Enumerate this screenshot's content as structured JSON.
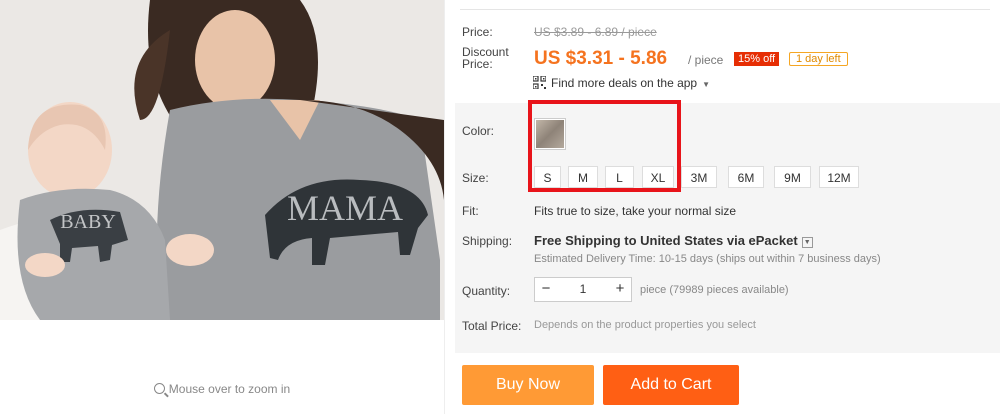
{
  "product_image": {
    "zoom_hint": "Mouse over to zoom in",
    "shirt_texts": [
      "MAMA",
      "BABY"
    ]
  },
  "price": {
    "label": "Price:",
    "original": "US $3.89 - 6.89 / piece",
    "discount_label_line1": "Discount",
    "discount_label_line2": "Price:",
    "discount": "US $3.31 - 5.86",
    "per": "/ piece",
    "off_badge": "15% off",
    "days_badge": "1 day left"
  },
  "app_deals": {
    "text": "Find more deals on the app"
  },
  "color": {
    "label": "Color:"
  },
  "size": {
    "label": "Size:",
    "options": [
      "S",
      "M",
      "L",
      "XL",
      "3M",
      "6M",
      "9M",
      "12M"
    ]
  },
  "fit": {
    "label": "Fit:",
    "value": "Fits true to size, take your normal size"
  },
  "shipping": {
    "label": "Shipping:",
    "value": "Free Shipping to United States via ePacket",
    "estimate": "Estimated Delivery Time: 10-15 days (ships out within 7 business days)"
  },
  "quantity": {
    "label": "Quantity:",
    "value": "1",
    "minus": "−",
    "plus": "+",
    "available": "piece (79989 pieces available)"
  },
  "total": {
    "label": "Total Price:",
    "value": "Depends on the product properties you select"
  },
  "actions": {
    "buy_now": "Buy Now",
    "add_to_cart": "Add to Cart"
  },
  "colors": {
    "accent_orange": "#f5731f",
    "buy_button": "#ff9a35",
    "cart_button": "#ff5f14",
    "highlight_box": "#e8141a",
    "off_badge_bg": "#e62e04"
  }
}
